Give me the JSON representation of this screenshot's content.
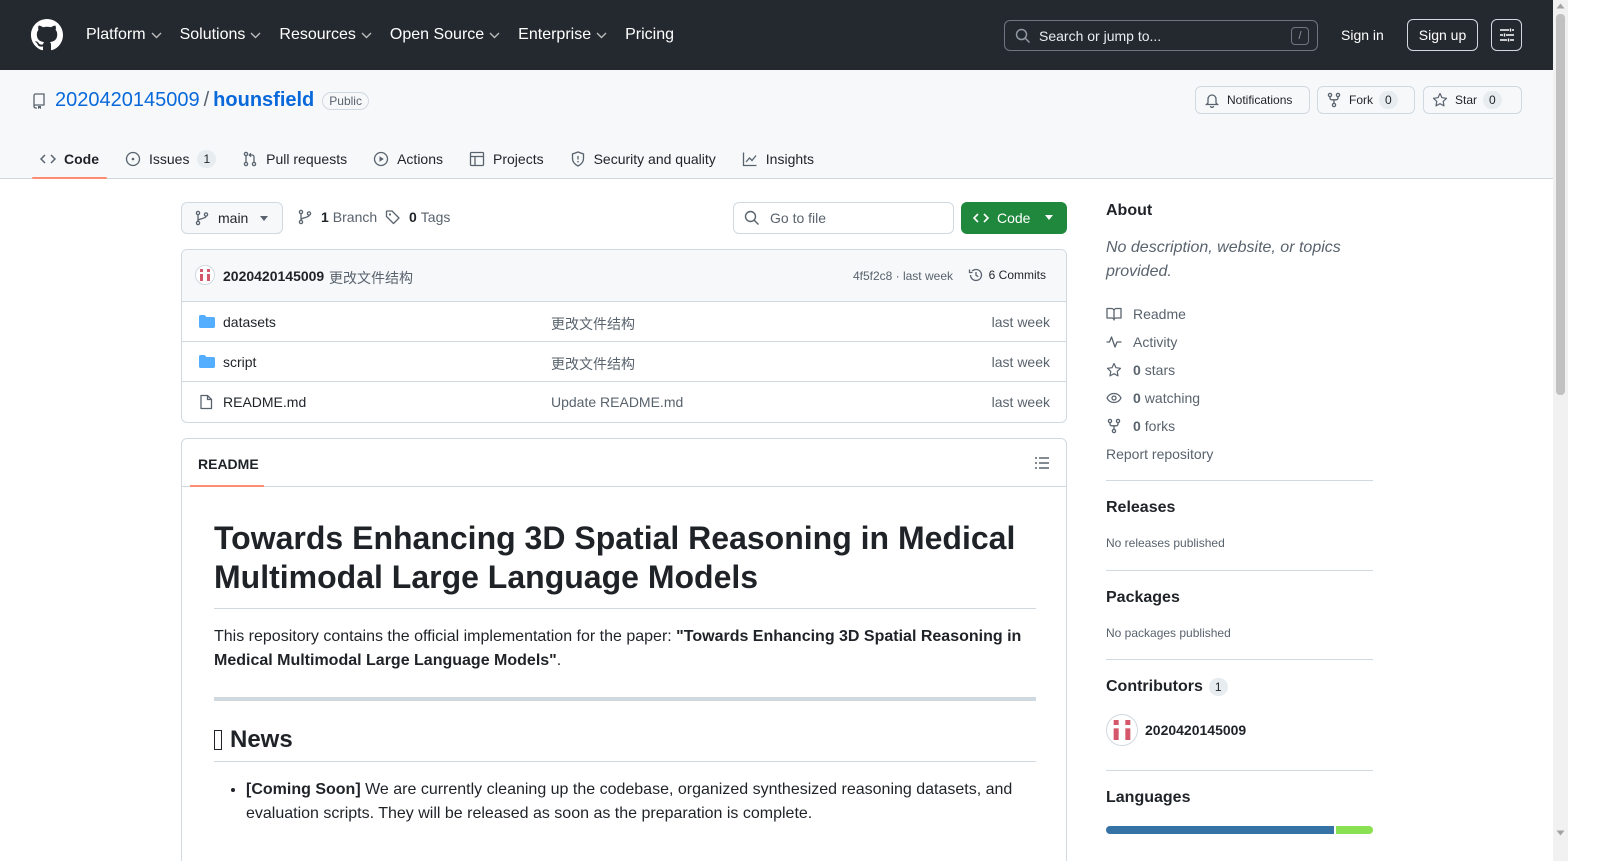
{
  "header": {
    "nav": [
      "Platform",
      "Solutions",
      "Resources",
      "Open Source",
      "Enterprise",
      "Pricing"
    ],
    "nav_has_caret": [
      true,
      true,
      true,
      true,
      true,
      false
    ],
    "search_placeholder": "Search or jump to...",
    "search_shortcut": "/",
    "sign_in": "Sign in",
    "sign_up": "Sign up"
  },
  "repo": {
    "owner": "2020420145009",
    "separator": "/",
    "name": "hounsfield",
    "visibility": "Public",
    "notifications_label": "Notifications",
    "fork_label": "Fork",
    "fork_count": "0",
    "star_label": "Star",
    "star_count": "0",
    "tabs": [
      {
        "label": "Code",
        "count": ""
      },
      {
        "label": "Issues",
        "count": "1"
      },
      {
        "label": "Pull requests",
        "count": ""
      },
      {
        "label": "Actions",
        "count": ""
      },
      {
        "label": "Projects",
        "count": ""
      },
      {
        "label": "Security and quality",
        "count": ""
      },
      {
        "label": "Insights",
        "count": ""
      }
    ]
  },
  "filenav": {
    "branch": "main",
    "branch_count": "1",
    "branch_label": "Branch",
    "tag_count": "0",
    "tag_label": "Tags",
    "goto_placeholder": "Go to file",
    "code_button": "Code"
  },
  "commit": {
    "author": "2020420145009",
    "message": "更改文件结构",
    "hash": "4f5f2c8 · last week",
    "commits": "6 Commits"
  },
  "files": [
    {
      "name": "datasets",
      "type": "folder",
      "message": "更改文件结构",
      "date": "last week"
    },
    {
      "name": "script",
      "type": "folder",
      "message": "更改文件结构",
      "date": "last week"
    },
    {
      "name": "README.md",
      "type": "file",
      "message": "Update README.md",
      "date": "last week"
    }
  ],
  "readme": {
    "tab": "README",
    "title": "Towards Enhancing 3D Spatial Reasoning in Medical Multimodal Large Language Models",
    "intro_prefix": "This repository contains the official implementation for the paper: ",
    "intro_bold": "\"Towards Enhancing 3D Spatial Reasoning in Medical Multimodal Large Language Models\"",
    "intro_suffix": ".",
    "news_heading": "News",
    "news_items": [
      {
        "tag": "[Coming Soon]",
        "text": " We are currently cleaning up the codebase, organized synthesized reasoning datasets, and evaluation scripts. They will be released as soon as the preparation is complete."
      }
    ]
  },
  "sidebar": {
    "about_title": "About",
    "about_desc": "No description, website, or topics provided.",
    "readme_link": "Readme",
    "activity_link": "Activity",
    "stars_count": "0",
    "stars_label": "stars",
    "watching_count": "0",
    "watching_label": "watching",
    "forks_count": "0",
    "forks_label": "forks",
    "report": "Report repository",
    "releases_title": "Releases",
    "releases_empty": "No releases published",
    "packages_title": "Packages",
    "packages_empty": "No packages published",
    "contributors_title": "Contributors",
    "contributors_count": "1",
    "contributor_name": "2020420145009",
    "languages_title": "Languages",
    "languages": [
      {
        "share": 86,
        "color": "#3572A5"
      },
      {
        "share": 14,
        "color": "#89e051"
      }
    ]
  },
  "colors": {
    "header_bg": "#24292f",
    "link": "#0969da",
    "code_button": "#1f883d",
    "tab_underline": "#fd8c73"
  }
}
